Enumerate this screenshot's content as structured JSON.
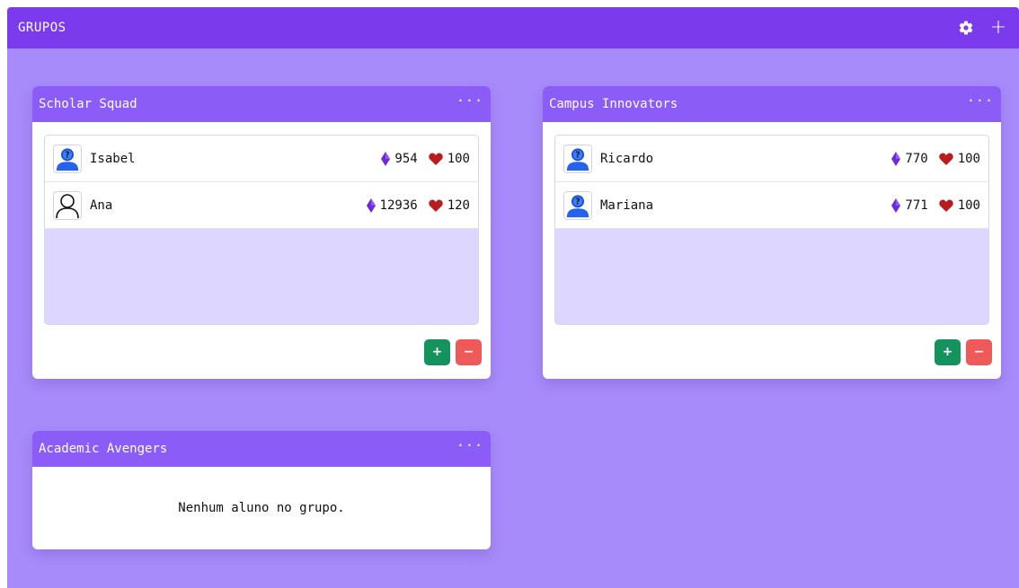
{
  "header": {
    "title": "GRUPOS",
    "settings_icon": "gear-icon",
    "add_icon": "plus-icon",
    "add_label": "+"
  },
  "groups": [
    {
      "name": "Scholar Squad",
      "menu": "···",
      "members": [
        {
          "name": "Isabel",
          "gems": "954",
          "hearts": "100",
          "avatar": "default-user-avatar"
        },
        {
          "name": "Ana",
          "gems": "12936",
          "hearts": "120",
          "avatar": "outline-user-avatar"
        }
      ],
      "add_label": "+",
      "remove_label": "−"
    },
    {
      "name": "Campus Innovators",
      "menu": "···",
      "members": [
        {
          "name": "Ricardo",
          "gems": "770",
          "hearts": "100",
          "avatar": "default-user-avatar"
        },
        {
          "name": "Mariana",
          "gems": "771",
          "hearts": "100",
          "avatar": "default-user-avatar"
        }
      ],
      "add_label": "+",
      "remove_label": "−"
    },
    {
      "name": "Academic Avengers",
      "menu": "···",
      "empty_message": "Nenhum aluno no grupo."
    }
  ],
  "colors": {
    "header": "#7c3aed",
    "board": "#a78bfa",
    "card_header": "#8b5cf6",
    "list_bg": "#ddd6fe",
    "add": "#15935f",
    "remove": "#ee5a5a",
    "gem": "#6d28d9",
    "heart": "#b91c1c"
  }
}
